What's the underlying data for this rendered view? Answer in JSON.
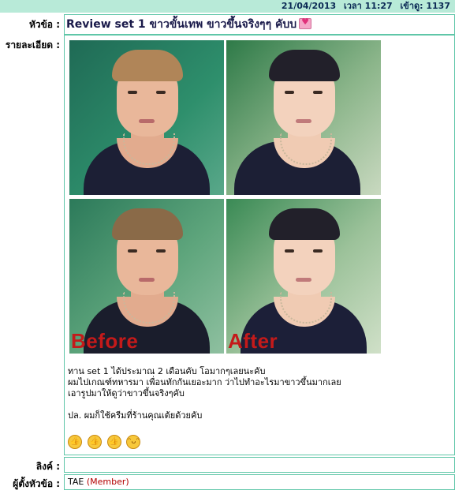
{
  "header": {
    "date": "21/04/2013",
    "time_label": "เวลา 11:27",
    "views_label": "เข้าดู: 1137"
  },
  "labels": {
    "topic": "หัวข้อ :",
    "details": "รายละเอียด :",
    "link": "ลิงค์ :",
    "author": "ผู้ตั้งหัวข้อ :"
  },
  "topic": {
    "title": "Review set 1 ขาวขั้นเทพ ขาวขึ้นจริงๆๆ คับบ"
  },
  "photos": {
    "before_caption": "Before",
    "after_caption": "After"
  },
  "body": {
    "lines": [
      "ทาน set 1 ได้ประมาณ 2 เดือนคับ โอมากๆเลยนะคับ",
      "ผมไปเกณฑ์ทหารมา เพื่อนทักกันเยอะมาก ว่าไปทำอะไรมาขาวขึ้นมากเลย",
      "เอารูปมาให้ดูว่าขาวขึ้นจริงๆคับ",
      "",
      "ปล. ผมก็ใช้ครีมที่ร้านคุณเต้ยด้วยคับ"
    ],
    "emoticons": [
      "thumbs-up-icon",
      "thumbs-up-icon",
      "thumbs-up-icon",
      "grin-icon"
    ]
  },
  "link": {
    "value": ""
  },
  "author": {
    "name": "TAE",
    "role": "(Member)"
  },
  "colors": {
    "accent": "#5fc6a8",
    "header_bg": "#b8ead8",
    "caption_red": "#c41a1a"
  }
}
